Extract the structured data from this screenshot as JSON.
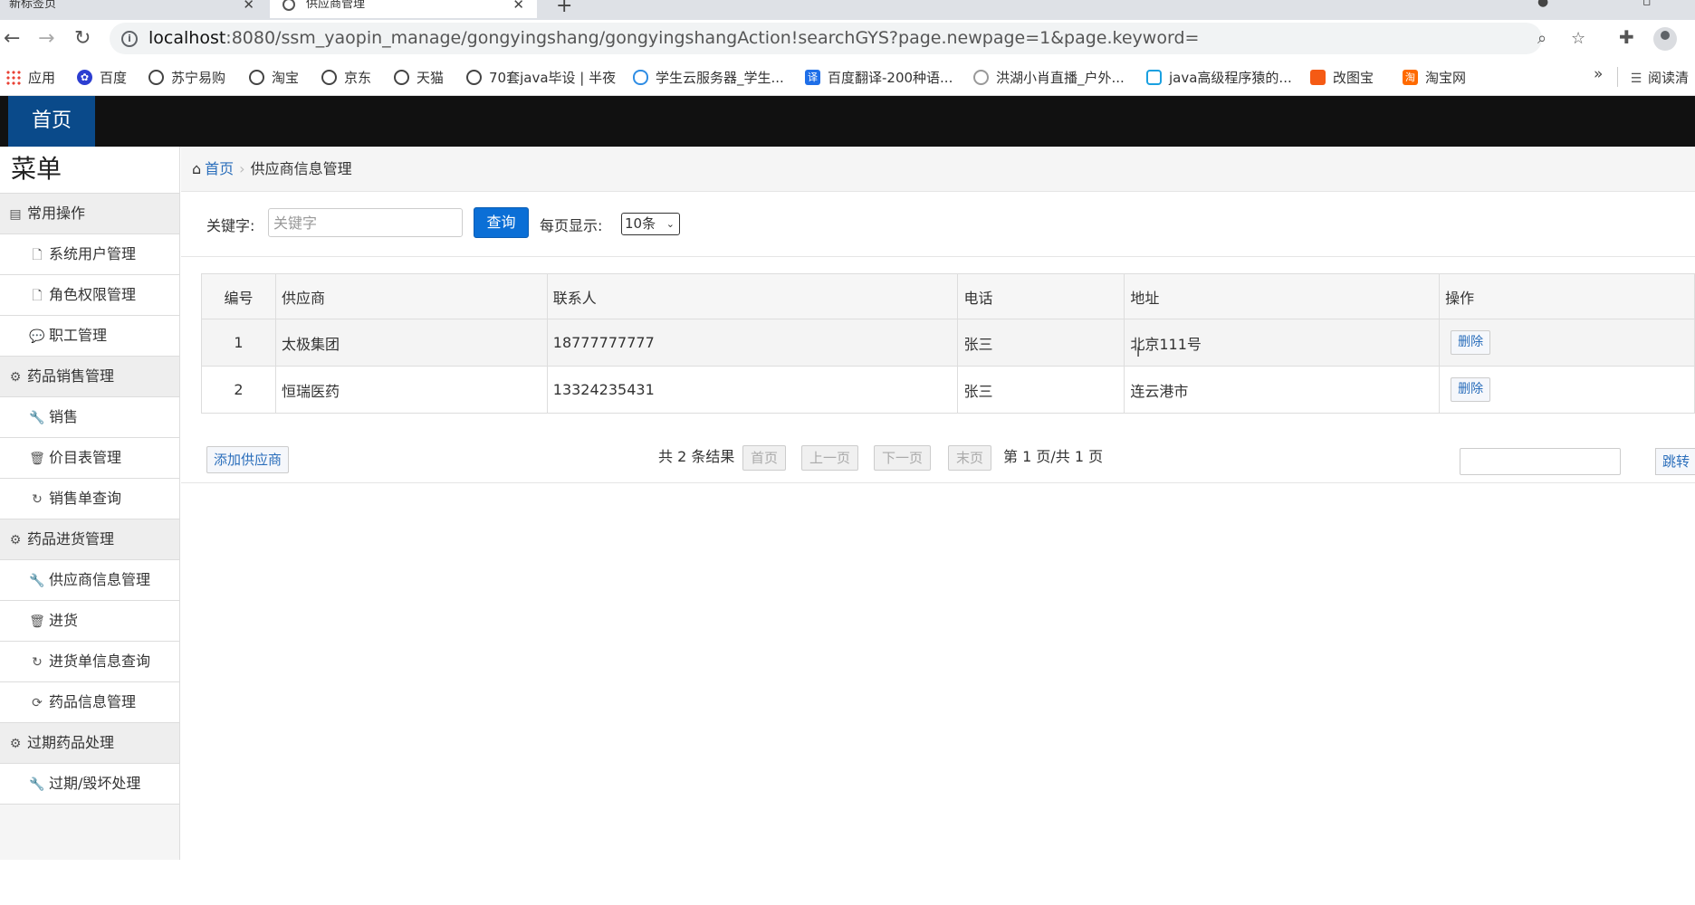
{
  "browser": {
    "tabs": [
      {
        "title": "新标签页"
      },
      {
        "title": "供应商管理"
      }
    ],
    "url_host": "localhost",
    "url_rest": ":8080/ssm_yaopin_manage/gongyingshang/gongyingshangAction!searchGYS?page.newpage=1&page.keyword=",
    "bookmarks": [
      {
        "label": "应用",
        "icon": "apps-icon"
      },
      {
        "label": "百度",
        "icon": "baidu-paw-icon"
      },
      {
        "label": "苏宁易购",
        "icon": "globe-icon"
      },
      {
        "label": "淘宝",
        "icon": "globe-icon"
      },
      {
        "label": "京东",
        "icon": "globe-icon"
      },
      {
        "label": "天猫",
        "icon": "globe-icon"
      },
      {
        "label": "70套java毕设 | 半夜",
        "icon": "globe-icon"
      },
      {
        "label": "学生云服务器_学生...",
        "icon": "cloud-icon"
      },
      {
        "label": "百度翻译-200种语...",
        "icon": "translate-icon"
      },
      {
        "label": "洪湖小肖直播_户外...",
        "icon": "bird-icon"
      },
      {
        "label": "java高级程序猿的...",
        "icon": "bilibili-tv-icon"
      },
      {
        "label": "改图宝",
        "icon": "gaitubao-icon"
      },
      {
        "label": "淘宝网",
        "icon": "taobao-icon"
      }
    ],
    "bookmark_more": "»",
    "reading_list": "阅读清"
  },
  "app": {
    "top_tab": "首页",
    "menu_title": "菜单",
    "sidebar": [
      {
        "type": "group",
        "label": "常用操作",
        "icon": "list-icon"
      },
      {
        "type": "item",
        "label": "系统用户管理",
        "icon": "file-icon"
      },
      {
        "type": "item",
        "label": "角色权限管理",
        "icon": "file-icon"
      },
      {
        "type": "item",
        "label": "职工管理",
        "icon": "comment-icon"
      },
      {
        "type": "group",
        "label": "药品销售管理",
        "icon": "gear-icon"
      },
      {
        "type": "item",
        "label": "销售",
        "icon": "wrench-icon"
      },
      {
        "type": "item",
        "label": "价目表管理",
        "icon": "trash-icon"
      },
      {
        "type": "item",
        "label": "销售单查询",
        "icon": "refresh-icon"
      },
      {
        "type": "group",
        "label": "药品进货管理",
        "icon": "gear-icon"
      },
      {
        "type": "item",
        "label": "供应商信息管理",
        "icon": "wrench-icon"
      },
      {
        "type": "item",
        "label": "进货",
        "icon": "trash-icon"
      },
      {
        "type": "item",
        "label": "进货单信息查询",
        "icon": "refresh-icon"
      },
      {
        "type": "item",
        "label": "药品信息管理",
        "icon": "sync-icon"
      },
      {
        "type": "group",
        "label": "过期药品处理",
        "icon": "gear-icon"
      },
      {
        "type": "item",
        "label": "过期/毁坏处理",
        "icon": "wrench-icon"
      }
    ],
    "breadcrumb": {
      "home": "首页",
      "current": "供应商信息管理"
    },
    "search": {
      "keyword_label": "关键字:",
      "keyword_placeholder": "关键字",
      "keyword_value": "",
      "query_button": "查询",
      "per_page_label": "每页显示:",
      "per_page_value": "10条"
    },
    "table": {
      "headers": [
        "编号",
        "供应商",
        "联系人",
        "电话",
        "地址",
        "操作"
      ],
      "rows": [
        {
          "id": "1",
          "supplier": "太极集团",
          "contact": "18777777777",
          "phone": "张三",
          "address": "北京111号",
          "action": "删除"
        },
        {
          "id": "2",
          "supplier": "恒瑞医药",
          "contact": "13324235431",
          "phone": "张三",
          "address": "连云港市",
          "action": "删除"
        }
      ]
    },
    "pager": {
      "add_button": "添加供应商",
      "total": "共 2 条结果",
      "first": "首页",
      "prev": "上一页",
      "next": "下一页",
      "last": "末页",
      "page_info": "第 1 页/共 1 页",
      "jump_value": "",
      "jump_button": "跳转"
    }
  }
}
